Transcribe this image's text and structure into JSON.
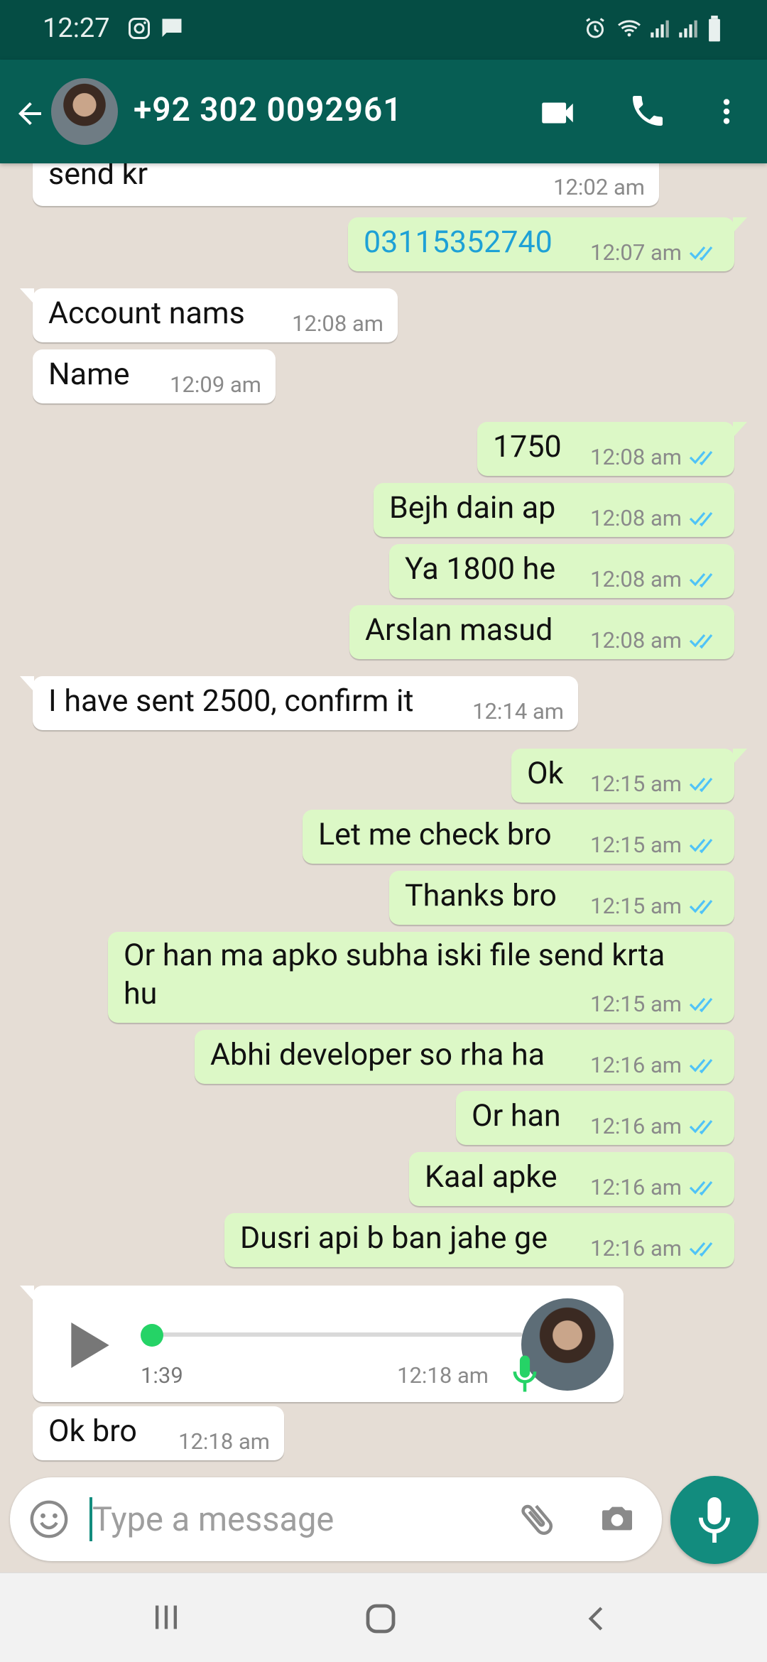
{
  "status_bar": {
    "time": "12:27"
  },
  "header": {
    "contact": "+92 302 0092961"
  },
  "messages": [
    {
      "dir": "in",
      "text": "send kr",
      "time": "12:02 am"
    },
    {
      "dir": "out",
      "text": "03115352740",
      "time": "12:07 am"
    },
    {
      "dir": "in",
      "text": "Account nams",
      "time": "12:08 am"
    },
    {
      "dir": "in",
      "text": "Name",
      "time": "12:09 am"
    },
    {
      "dir": "out",
      "text": "1750",
      "time": "12:08 am"
    },
    {
      "dir": "out",
      "text": "Bejh dain ap",
      "time": "12:08 am"
    },
    {
      "dir": "out",
      "text": "Ya 1800 he",
      "time": "12:08 am"
    },
    {
      "dir": "out",
      "text": "Arslan masud",
      "time": "12:08 am"
    },
    {
      "dir": "in",
      "text": "I have sent 2500, confirm it",
      "time": "12:14 am"
    },
    {
      "dir": "out",
      "text": "Ok",
      "time": "12:15 am"
    },
    {
      "dir": "out",
      "text": "Let me check bro",
      "time": "12:15 am"
    },
    {
      "dir": "out",
      "text": "Thanks bro",
      "time": "12:15 am"
    },
    {
      "dir": "out",
      "text": "Or han ma apko subha iski file send krta",
      "text2": "hu",
      "time": "12:15 am"
    },
    {
      "dir": "out",
      "text": "Abhi developer so rha ha",
      "time": "12:16 am"
    },
    {
      "dir": "out",
      "text": "Or han",
      "time": "12:16 am"
    },
    {
      "dir": "out",
      "text": "Kaal apke",
      "time": "12:16 am"
    },
    {
      "dir": "out",
      "text": "Dusri api b ban jahe ge",
      "time": "12:16 am"
    },
    {
      "dir": "in",
      "type": "voice",
      "duration": "1:39",
      "time": "12:18 am",
      "played": 0.0
    },
    {
      "dir": "in",
      "text": "Ok bro",
      "time": "12:18 am"
    }
  ],
  "composer": {
    "placeholder": "Type a message"
  },
  "colors": {
    "header": "#075e54",
    "status_bar": "#054d44",
    "outgoing": "#dcf8c6",
    "incoming": "#ffffff",
    "chat_bg": "#e5ddd5",
    "read_ticks": "#4fc3f7",
    "accent": "#128c7e"
  },
  "icons": [
    "back-arrow-icon",
    "video-call-icon",
    "phone-icon",
    "more-vert-icon",
    "emoji-icon",
    "attach-icon",
    "camera-icon",
    "mic-icon",
    "play-icon"
  ]
}
